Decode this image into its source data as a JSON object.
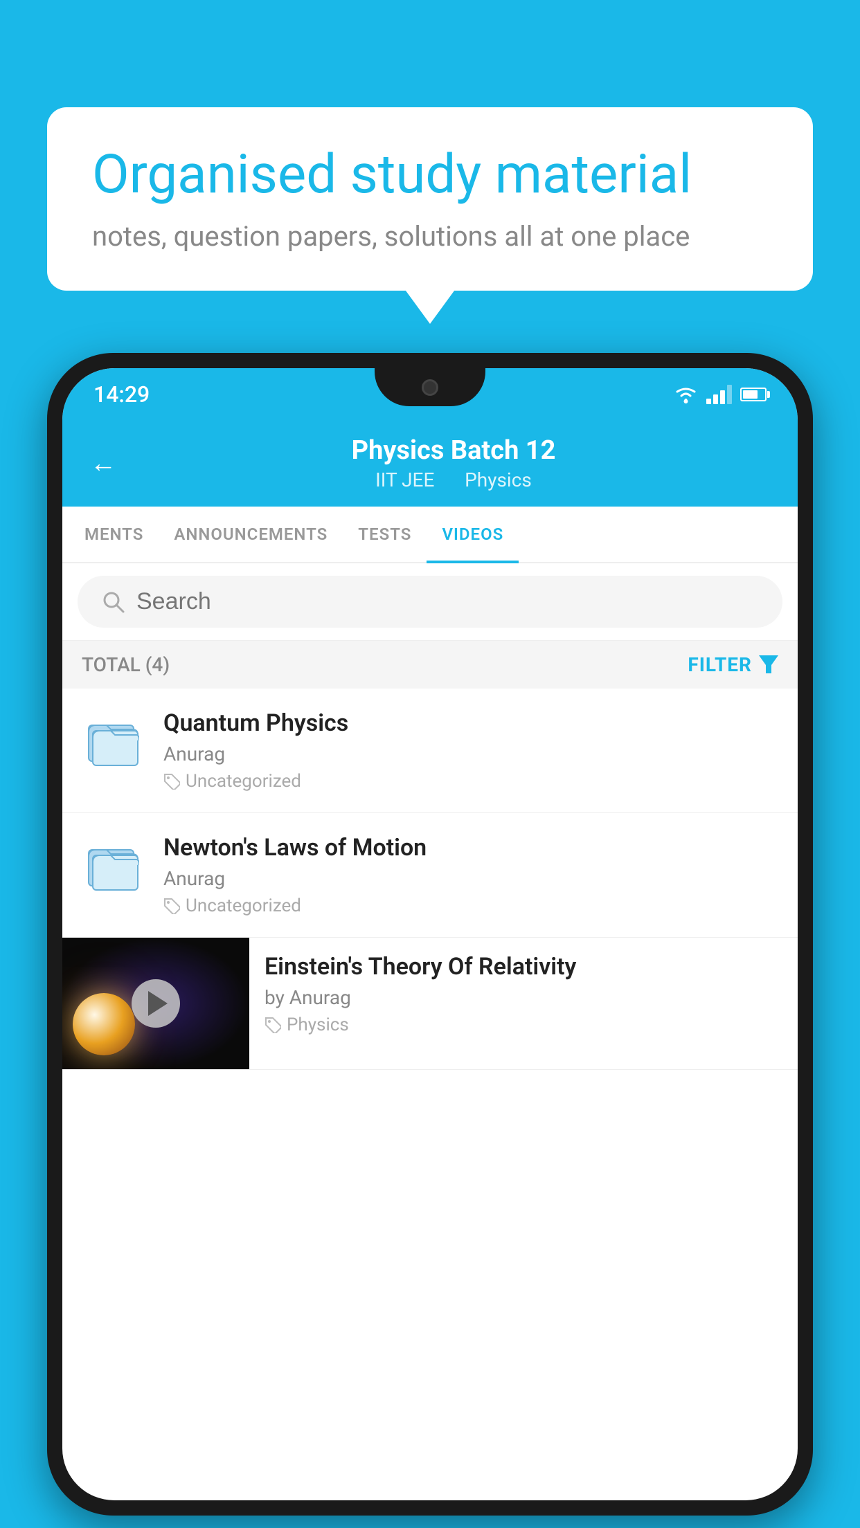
{
  "page": {
    "background_color": "#1ab8e8"
  },
  "speech_bubble": {
    "title": "Organised study material",
    "subtitle": "notes, question papers, solutions all at one place"
  },
  "status_bar": {
    "time": "14:29"
  },
  "app_header": {
    "title": "Physics Batch 12",
    "subtitle_part1": "IIT JEE",
    "subtitle_part2": "Physics",
    "back_label": "←"
  },
  "tabs": [
    {
      "label": "MENTS",
      "active": false
    },
    {
      "label": "ANNOUNCEMENTS",
      "active": false
    },
    {
      "label": "TESTS",
      "active": false
    },
    {
      "label": "VIDEOS",
      "active": true
    }
  ],
  "search": {
    "placeholder": "Search"
  },
  "filter_bar": {
    "total_label": "TOTAL (4)",
    "filter_label": "FILTER"
  },
  "videos": [
    {
      "id": 1,
      "title": "Quantum Physics",
      "author": "Anurag",
      "tag": "Uncategorized",
      "has_thumbnail": false
    },
    {
      "id": 2,
      "title": "Newton's Laws of Motion",
      "author": "Anurag",
      "tag": "Uncategorized",
      "has_thumbnail": false
    },
    {
      "id": 3,
      "title": "Einstein's Theory Of Relativity",
      "author": "by Anurag",
      "tag": "Physics",
      "has_thumbnail": true
    }
  ]
}
